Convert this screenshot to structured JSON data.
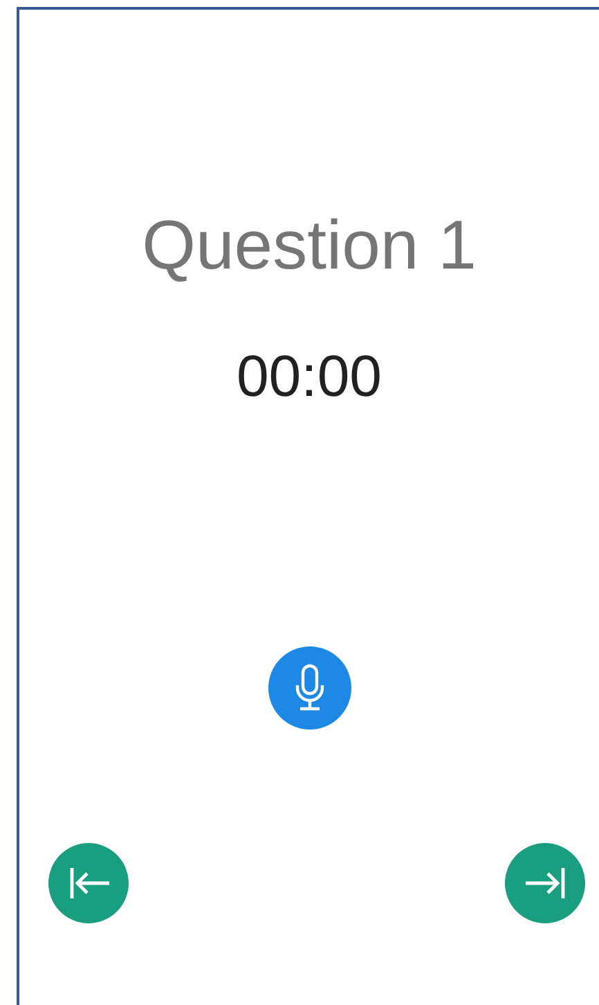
{
  "question": {
    "title": "Question 1",
    "timer": "00:00"
  }
}
